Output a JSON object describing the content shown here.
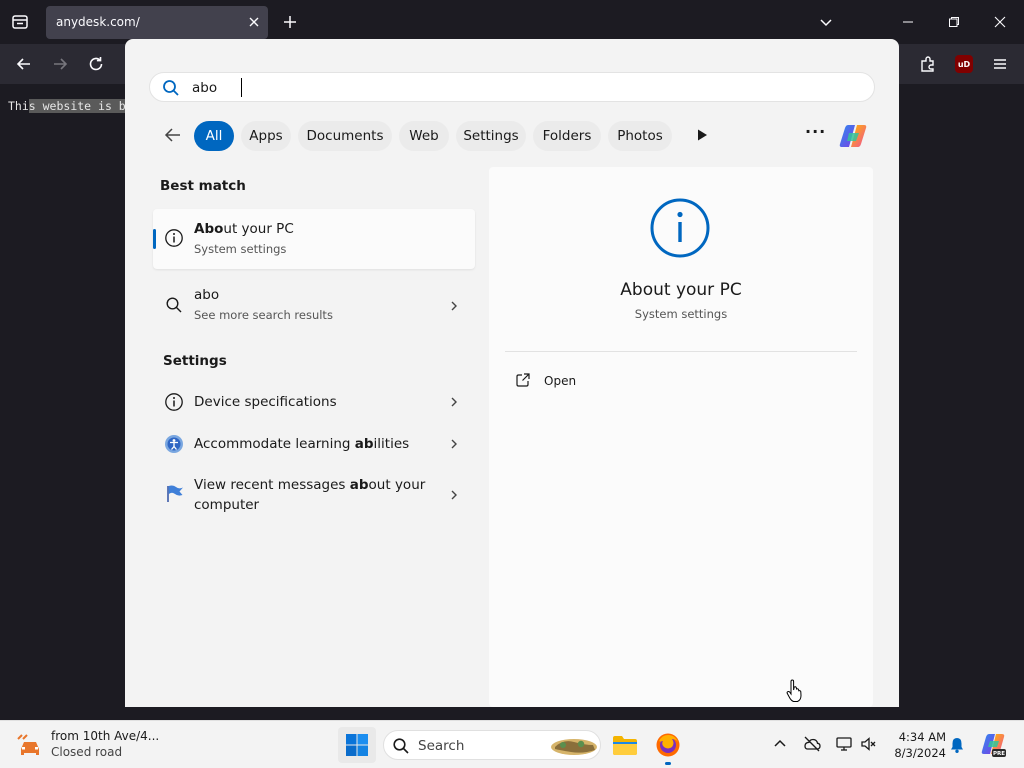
{
  "browser": {
    "tab_title": "anydesk.com/",
    "page_text_plain": "Thi",
    "page_text_highlight": "s website is b"
  },
  "search_panel": {
    "query": "abo",
    "filters": [
      "All",
      "Apps",
      "Documents",
      "Web",
      "Settings",
      "Folders",
      "Photos"
    ],
    "active_filter": "All",
    "best_match_heading": "Best match",
    "best_match": {
      "title_bold": "Abo",
      "title_rest": "ut your PC",
      "subtitle": "System settings",
      "icon": "info-icon"
    },
    "web_result": {
      "title": "abo",
      "subtitle": "See more search results",
      "icon": "search-icon"
    },
    "settings_heading": "Settings",
    "settings_results": [
      {
        "pre": "Device specifications",
        "bold": "",
        "post": "",
        "icon": "info-icon"
      },
      {
        "pre": "Accommodate learning ",
        "bold": "ab",
        "post": "ilities",
        "icon": "accessibility-icon"
      },
      {
        "pre": "View recent messages ",
        "bold": "ab",
        "post": "out your",
        "line2": "computer",
        "icon": "flag-icon"
      }
    ],
    "preview": {
      "title": "About your PC",
      "subtitle": "System settings",
      "action_label": "Open",
      "icon": "info-icon"
    }
  },
  "taskbar": {
    "weather_line1": "from 10th Ave/4...",
    "weather_line2": "Closed road",
    "search_label": "Search",
    "time": "4:34 AM",
    "date": "8/3/2024"
  },
  "colors": {
    "accent": "#0067c0",
    "browser_bg": "#1c1b22",
    "toolbar_bg": "#2b2a33",
    "panel_bg": "#f3f3f3"
  }
}
